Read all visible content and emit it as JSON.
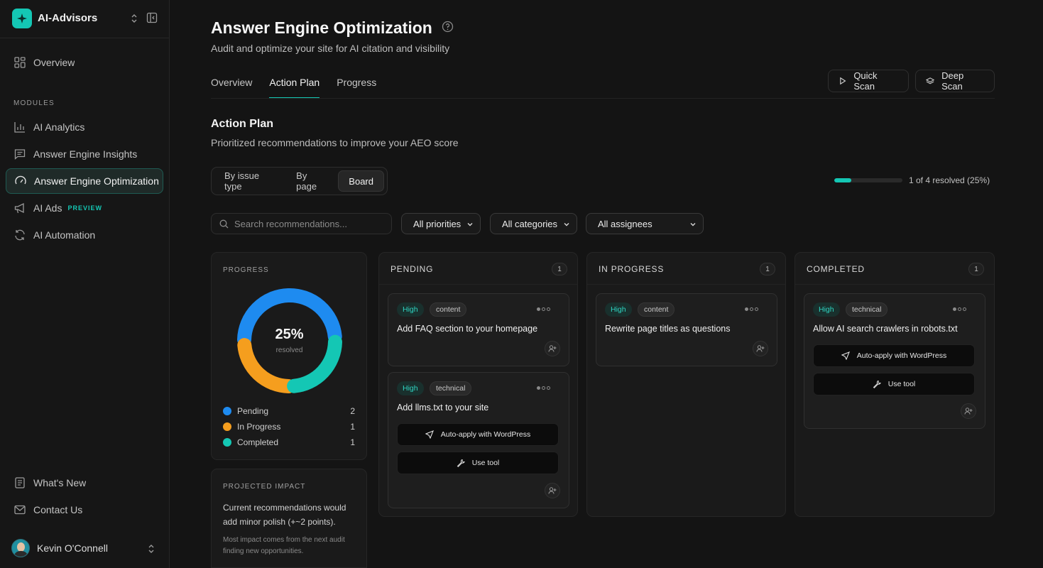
{
  "sidebar": {
    "brand": "AI-Advisors",
    "overview": "Overview",
    "modules_label": "MODULES",
    "items": [
      {
        "label": "AI Analytics"
      },
      {
        "label": "Answer Engine Insights"
      },
      {
        "label": "Answer Engine Optimization"
      },
      {
        "label": "AI Ads",
        "badge": "PREVIEW"
      },
      {
        "label": "AI Automation"
      }
    ],
    "whats_new": "What's New",
    "contact": "Contact Us",
    "user_name": "Kevin O'Connell"
  },
  "header": {
    "title": "Answer Engine Optimization",
    "subtitle": "Audit and optimize your site for AI citation and visibility"
  },
  "tabs": [
    {
      "label": "Overview"
    },
    {
      "label": "Action Plan",
      "active": true
    },
    {
      "label": "Progress"
    }
  ],
  "actions": {
    "quick_scan": "Quick Scan",
    "deep_scan": "Deep Scan"
  },
  "action_plan": {
    "title": "Action Plan",
    "subtitle": "Prioritized recommendations to improve your AEO score",
    "views": [
      "By issue type",
      "By page",
      "Board"
    ],
    "active_view": "Board",
    "resolved_text": "1 of 4 resolved (25%)",
    "resolved_fraction": 0.25
  },
  "filters": {
    "search_placeholder": "Search recommendations...",
    "priorities": "All priorities",
    "categories": "All categories",
    "assignees": "All assignees"
  },
  "progress_panel": {
    "label": "PROGRESS",
    "value": "25%",
    "sub": "resolved",
    "legend": [
      {
        "label": "Pending",
        "count": "2",
        "color": "#1e8bf0"
      },
      {
        "label": "In Progress",
        "count": "1",
        "color": "#f59e1e"
      },
      {
        "label": "Completed",
        "count": "1",
        "color": "#14c7b4"
      }
    ]
  },
  "impact_panel": {
    "label": "PROJECTED IMPACT",
    "text": "Current recommendations would add minor polish (+~2 points).",
    "note": "Most impact comes from the next audit finding new opportunities."
  },
  "columns": [
    {
      "title": "PENDING",
      "count": "1",
      "cards": [
        {
          "priority": "High",
          "category": "content",
          "title": "Add FAQ section to your homepage"
        },
        {
          "priority": "High",
          "category": "technical",
          "title": "Add llms.txt to your site",
          "btn1": "Auto-apply with WordPress",
          "btn2": "Use tool"
        }
      ]
    },
    {
      "title": "IN PROGRESS",
      "count": "1",
      "cards": [
        {
          "priority": "High",
          "category": "content",
          "title": "Rewrite page titles as questions"
        }
      ]
    },
    {
      "title": "COMPLETED",
      "count": "1",
      "cards": [
        {
          "priority": "High",
          "category": "technical",
          "title": "Allow AI search crawlers in robots.txt",
          "btn1": "Auto-apply with WordPress",
          "btn2": "Use tool"
        }
      ]
    }
  ]
}
